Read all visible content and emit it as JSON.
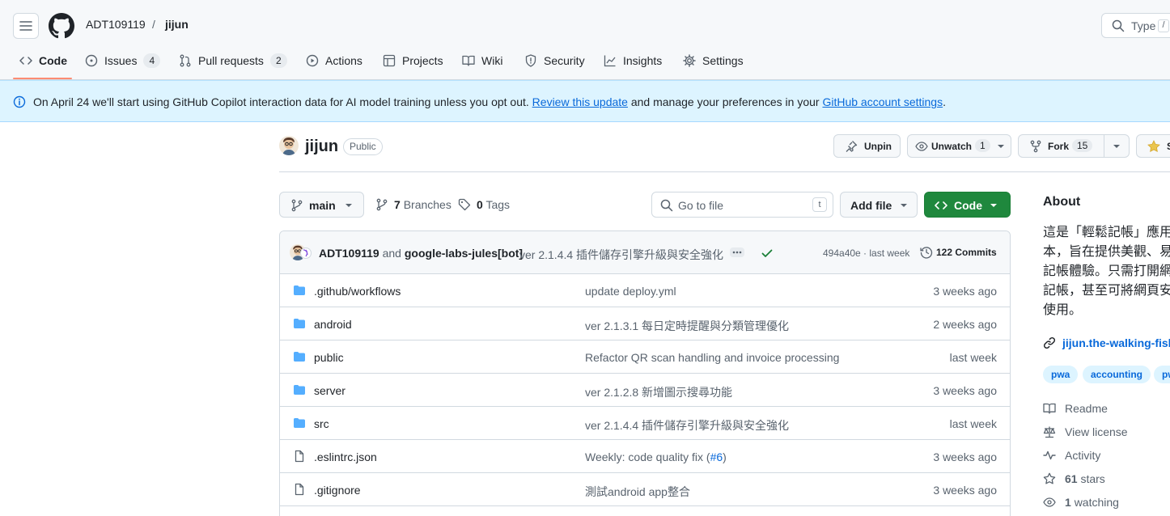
{
  "header": {
    "owner": "ADT109119",
    "separator": "/",
    "repo": "jijun",
    "search_placeholder": "Type",
    "search_key": "/"
  },
  "tabs": [
    {
      "label": "Code",
      "icon": "code-icon",
      "active": true
    },
    {
      "label": "Issues",
      "icon": "issue-opened-icon",
      "count": "4"
    },
    {
      "label": "Pull requests",
      "icon": "git-pull-request-icon",
      "count": "2"
    },
    {
      "label": "Actions",
      "icon": "play-icon"
    },
    {
      "label": "Projects",
      "icon": "table-icon"
    },
    {
      "label": "Wiki",
      "icon": "book-icon"
    },
    {
      "label": "Security",
      "icon": "shield-icon"
    },
    {
      "label": "Insights",
      "icon": "graph-icon"
    },
    {
      "label": "Settings",
      "icon": "gear-icon"
    }
  ],
  "banner": {
    "text1": "On April 24 we'll start using GitHub Copilot interaction data for AI model training unless you opt out. ",
    "link1": "Review this update",
    "text2": " and manage your preferences in your ",
    "link2": "GitHub account settings",
    "text3": "."
  },
  "repo": {
    "name": "jijun",
    "visibility": "Public",
    "unpin": "Unpin",
    "unwatch": "Unwatch",
    "watch_count": "1",
    "fork": "Fork",
    "fork_count": "15",
    "star": "S"
  },
  "toolbar": {
    "branch": "main",
    "branches_count": "7",
    "branches_label": "Branches",
    "tags_count": "0",
    "tags_label": "Tags",
    "goto_placeholder": "Go to file",
    "goto_key": "t",
    "add_file": "Add file",
    "code": "Code"
  },
  "latest_commit": {
    "author1": "ADT109119",
    "and": "and",
    "author2": "google-labs-jules[bot]",
    "message": "ver 2.1.4.4 插件儲存引擎升級與安全強化",
    "hash_time": "494a40e · last week",
    "commits": "122 Commits"
  },
  "files": [
    {
      "name": ".github/workflows",
      "type": "folder",
      "message": "update deploy.yml",
      "date": "3 weeks ago"
    },
    {
      "name": "android",
      "type": "folder",
      "message": "ver 2.1.3.1 每日定時提醒與分類管理優化",
      "date": "2 weeks ago"
    },
    {
      "name": "public",
      "type": "folder",
      "message": "Refactor QR scan handling and invoice processing",
      "date": "last week"
    },
    {
      "name": "server",
      "type": "folder",
      "message": "ver 2.1.2.8 新增圖示搜尋功能",
      "date": "3 weeks ago"
    },
    {
      "name": "src",
      "type": "folder",
      "message": "ver 2.1.4.4 插件儲存引擎升級與安全強化",
      "date": "last week"
    },
    {
      "name": ".eslintrc.json",
      "type": "file",
      "message": "Weekly: code quality fix (",
      "message_link": "#6",
      "message_end": ")",
      "date": "3 weeks ago"
    },
    {
      "name": ".gitignore",
      "type": "file",
      "message": "測試android app整合",
      "date": "3 weeks ago"
    }
  ],
  "about": {
    "title": "About",
    "description": "這是「輕鬆記帳」應用\n本，旨在提供美觀、易\n記帳體驗。只需打開網\n記帳，甚至可將網頁安\n使用。",
    "link": "jijun.the-walking-fish",
    "topics": [
      "pwa",
      "accounting",
      "pw"
    ],
    "readme": "Readme",
    "license": "View license",
    "activity": "Activity",
    "stars": "61",
    "stars_label": "stars",
    "watching": "1",
    "watching_label": "watching"
  },
  "colors": {
    "accent_green": "#1f883d",
    "link_blue": "#0969da",
    "banner_bg": "#ddf4ff",
    "folder_blue": "#54aeff",
    "underline": "#fd8c73"
  }
}
